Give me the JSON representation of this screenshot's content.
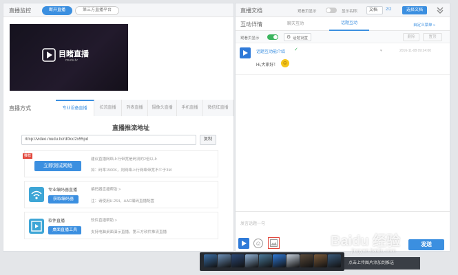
{
  "live": {
    "title": "直播监控",
    "start_button": "断开直播",
    "third_party_button": "第三方直播平台",
    "video_logo_text": "目睹直播",
    "video_logo_sub": "mudu.tv"
  },
  "method": {
    "title": "直播方式",
    "tabs": [
      "专业设备直播",
      "拉流直播",
      "列表直播",
      "摄像头直播",
      "手机直播",
      "微信红直播"
    ],
    "active_tab": 0,
    "push_title": "直播推流地址",
    "push_url": "rtmp://video.mudu.tv/rd0kx/2x55pd",
    "copy_button": "复制"
  },
  "cards": [
    {
      "badge": "推荐",
      "button": "立即测试网络",
      "lines": [
        "建议直播网络上行带宽是码流的2倍以上",
        "如：码率1500K，则网络上行网络带宽不少于3M"
      ]
    },
    {
      "heading": "专业编码器直播",
      "button": "获取编码器",
      "lines": [
        "编码器直播帮助 >",
        "注：请使用H.264，AAC编码直播配置"
      ]
    },
    {
      "heading": "软件直播",
      "button": "桌面直播工具",
      "lines": [
        "软件直播帮助 >",
        "支持电脑桌面演示直播，第三方软件推流直播"
      ]
    }
  ],
  "doc": {
    "title": "直播文档",
    "toggle_label": "观看页显示",
    "display_label": "显示名称：",
    "display_value": "文档",
    "page": "2/2",
    "select_button": "选择文档",
    "collapse_icon": "chevron-double-down-icon"
  },
  "interaction": {
    "title": "互动详情",
    "tabs": [
      "聊天互动",
      "话题互动"
    ],
    "active_tab": 1,
    "right_link": "自定义菜单 »",
    "toggle_label": "观看页显示",
    "settings_label": "话题设置",
    "action_buttons": [
      "删除",
      "置顶"
    ],
    "topic_title": "话题互动能介绍",
    "topic_meta": "2016-11-08 09:24:00",
    "topic_message": "Hi,大家好！",
    "input_placeholder": "发言话题一句",
    "send_button": "发送"
  },
  "accent": "#3b8fe0",
  "picker_tooltip": "点击上传图片添加到推送",
  "watermark": "Baidu 经验",
  "watermark_sub": "jingyan.baidu.com",
  "picker_thumbs": [
    "#3a6ea5",
    "#6b8fb8",
    "#2c4a78",
    "#8fb2d6",
    "#4a7a9b",
    "#2f7ad8",
    "#c4cfdb",
    "#5a4a3a",
    "#7a5a3a",
    "#3a5a7a"
  ]
}
